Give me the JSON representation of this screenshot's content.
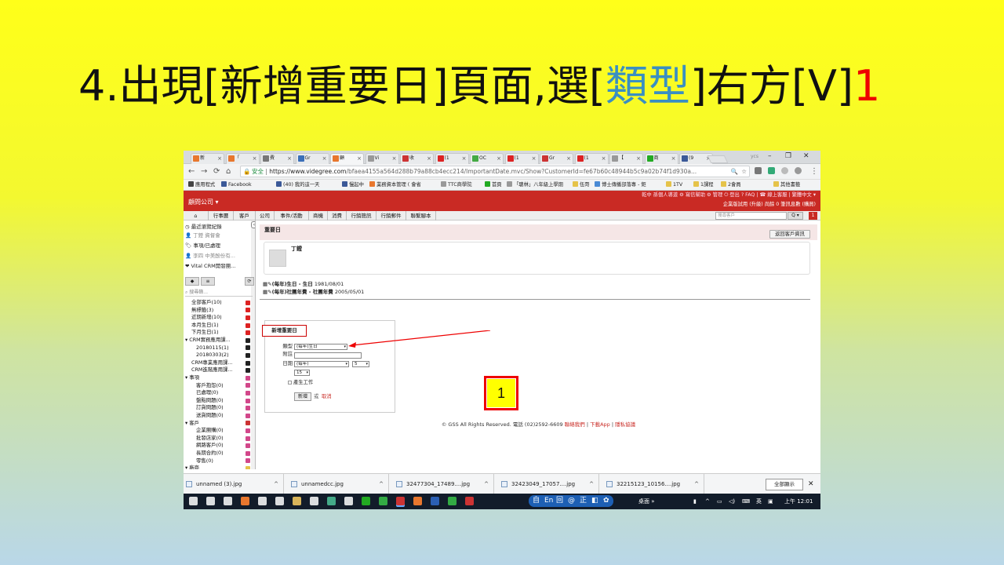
{
  "slide": {
    "title_prefix": "4.出現[新增重要日]頁面,選[",
    "title_highlight": "類型",
    "title_suffix": "]右方[V]",
    "title_number": "1"
  },
  "browser": {
    "tabs": [
      {
        "label": "新",
        "color": "#e8772e"
      },
      {
        "label": "「",
        "color": "#e8772e"
      },
      {
        "label": "費",
        "color": "#777"
      },
      {
        "label": "Gr",
        "color": "#3b6fb8"
      },
      {
        "label": "顧",
        "color": "#e8772e"
      },
      {
        "label": "Vi",
        "color": "#999"
      },
      {
        "label": "收",
        "color": "#c33"
      },
      {
        "label": "(1",
        "color": "#d22"
      },
      {
        "label": "OC",
        "color": "#4a4"
      },
      {
        "label": "(1",
        "color": "#d22"
      },
      {
        "label": "Gr",
        "color": "#c33"
      },
      {
        "label": "(1",
        "color": "#d22"
      },
      {
        "label": "【",
        "color": "#999"
      },
      {
        "label": "商",
        "color": "#2a2"
      },
      {
        "label": "(9",
        "color": "#3b5998"
      }
    ],
    "profile": "ycs",
    "address": {
      "secure_label": "安全",
      "host": "https://www.videgree.com",
      "path": "/bfaea4155a564d288b79a88cb4ecc214/ImportantDate.mvc/Show?CustomerId=fe67b60c48944b5c9a02b74f1d930a..."
    },
    "bookmarks": [
      {
        "label": "應用程式",
        "color": "#444"
      },
      {
        "label": "Facebook",
        "color": "#3b5998"
      },
      {
        "label": "(40) 我的這一天",
        "color": "#3b5998"
      },
      {
        "label": "慢起中",
        "color": "#3b5998"
      },
      {
        "label": "業務資本管理 ( 會省",
        "color": "#e8772e"
      },
      {
        "label": "TTC商學院",
        "color": "#999"
      },
      {
        "label": "首頁",
        "color": "#2a2"
      },
      {
        "label": "「聰林」八年級上學期",
        "color": "#999"
      },
      {
        "label": "伍哥",
        "color": "#e5c34a"
      },
      {
        "label": "博士傳播部落專 - 鉅",
        "color": "#4a8ad4"
      },
      {
        "label": "1TV",
        "color": "#e5c34a"
      },
      {
        "label": "1課程",
        "color": "#e5c34a"
      },
      {
        "label": "2會員",
        "color": "#e5c34a"
      },
      {
        "label": "其他書籤",
        "color": "#e5c34a"
      }
    ]
  },
  "app": {
    "company": "顧問公司 ▾",
    "top_links": "乾中 孫個人導遊  ⚙ 寫信幫助  ⚙ 管理  ⏻ 登出  ? FAQ  |  ☎ 線上客服  |  繁體中文 ▾",
    "plan_text": "企業版試用 (升級) 尚餘 0 筆訊息數 (購買)",
    "menu": [
      "行事曆",
      "客戶",
      "公司",
      "事件/活動",
      "商機",
      "消費",
      "行銷簡訊",
      "行銷郵件",
      "聯繫腳本"
    ],
    "search_placeholder": "搜尋客戶",
    "search_button": "Q ▾",
    "alert_count": "1"
  },
  "sidebar": {
    "recent_title": "最近瀏覽紀錄",
    "recent": [
      {
        "label": "丁鐙 資督會",
        "muted": true
      },
      {
        "label": "事項/已處理",
        "muted": false
      },
      {
        "label": "李四 中美酚份有...",
        "muted": true
      },
      {
        "label": "Vital CRM開發團...",
        "muted": false
      }
    ],
    "search_placeholder": "搜尋篩...",
    "tree": [
      {
        "label": "全部客戶(10)",
        "indent": 1,
        "color": "#d22"
      },
      {
        "label": "無標籤(3)",
        "indent": 1,
        "color": "#d22"
      },
      {
        "label": "近期新增(10)",
        "indent": 1,
        "color": "#d22"
      },
      {
        "label": "本月生日(1)",
        "indent": 1,
        "color": "#d22"
      },
      {
        "label": "下月生日(1)",
        "indent": 1,
        "color": "#d22"
      },
      {
        "label": "▾ CRM實務應用課...",
        "indent": 0,
        "color": "#222"
      },
      {
        "label": "20180115(1)",
        "indent": 2,
        "color": "#222"
      },
      {
        "label": "20180303(2)",
        "indent": 2,
        "color": "#222"
      },
      {
        "label": "CRM專業應用課...",
        "indent": 1,
        "color": "#222"
      },
      {
        "label": "CRM進階應用課...",
        "indent": 1,
        "color": "#222"
      },
      {
        "label": "▾ 事項",
        "indent": 0,
        "color": "#d2478a"
      },
      {
        "label": "客戶抱怨(0)",
        "indent": 2,
        "color": "#d2478a"
      },
      {
        "label": "已處理(0)",
        "indent": 2,
        "color": "#d2478a"
      },
      {
        "label": "盤點問題(0)",
        "indent": 2,
        "color": "#d2478a"
      },
      {
        "label": "訂貨問題(0)",
        "indent": 2,
        "color": "#d2478a"
      },
      {
        "label": "送貨問題(0)",
        "indent": 2,
        "color": "#d2478a"
      },
      {
        "label": "▾ 客戶",
        "indent": 0,
        "color": "#c33"
      },
      {
        "label": "企業團購(0)",
        "indent": 2,
        "color": "#d2478a"
      },
      {
        "label": "批發店家(0)",
        "indent": 2,
        "color": "#d2478a"
      },
      {
        "label": "網路客戶(0)",
        "indent": 2,
        "color": "#d2478a"
      },
      {
        "label": "長期合約(0)",
        "indent": 2,
        "color": "#d2478a"
      },
      {
        "label": "零售(0)",
        "indent": 2,
        "color": "#d2478a"
      },
      {
        "label": "▾ 廠商",
        "indent": 0,
        "color": "#e5c34a"
      }
    ]
  },
  "main": {
    "page_title": "重要日",
    "back_button": "返回客戶資訊",
    "customer_name": "丁鐙",
    "dates": [
      {
        "label": "(每年)生日 - 生日",
        "value": "1981/08/01"
      },
      {
        "label": "(每年)社團年費 - 社團年費",
        "value": "2005/05/01"
      }
    ],
    "form": {
      "title": "新增重要日",
      "type_label": "類型",
      "type_value": "(每年)生日",
      "note_label": "附註",
      "date_label": "日期",
      "date_freq": "(每年)",
      "date_month": "5",
      "date_day": "15",
      "gen_task_label": "產生工作",
      "submit": "新增",
      "or_text": "或",
      "cancel": "取消"
    },
    "footer_copy": "© GSS All Rights Reserved. 電話 (02)2592-6609",
    "footer_links": [
      "聯絡我們",
      "下載App",
      "隱私協議"
    ],
    "callout_number": "1"
  },
  "downloads": {
    "items": [
      "unnamed (3).jpg",
      "unnamedcc.jpg",
      "32477304_17489....jpg",
      "32423049_17057....jpg",
      "32215123_10156....jpg"
    ],
    "show_all": "全部顯示"
  },
  "taskbar": {
    "ime": [
      "自",
      "En",
      "回",
      "@",
      "正",
      "◧",
      "✿"
    ],
    "desktop": "桌面 »",
    "lang": "英",
    "time": "上午 12:01"
  }
}
